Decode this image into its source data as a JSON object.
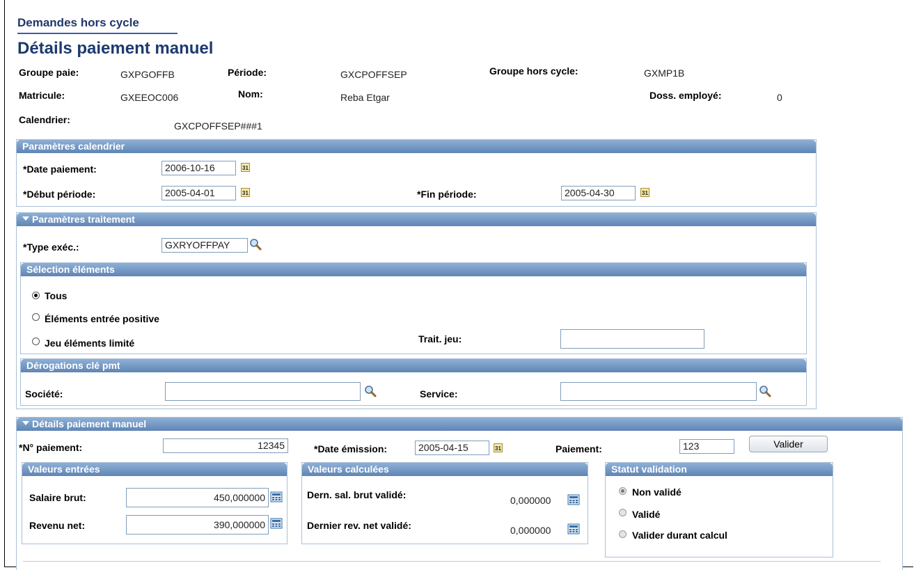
{
  "breadcrumb": "Demandes hors cycle",
  "page_title": "Détails paiement manuel",
  "header": {
    "groupe_paie_label": "Groupe paie:",
    "groupe_paie_value": "GXPGOFFB",
    "periode_label": "Période:",
    "periode_value": "GXCPOFFSEP",
    "groupe_hors_cycle_label": "Groupe hors cycle:",
    "groupe_hors_cycle_value": "GXMP1B",
    "matricule_label": "Matricule:",
    "matricule_value": "GXEEOC006",
    "nom_label": "Nom:",
    "nom_value": "Reba Etgar",
    "doss_label": "Doss. employé:",
    "doss_value": "0",
    "calendrier_label": "Calendrier:",
    "calendrier_value": "GXCPOFFSEP###1"
  },
  "calendar_params": {
    "title": "Paramètres calendrier",
    "date_paiement_label": "*Date paiement:",
    "date_paiement_value": "2006-10-16",
    "debut_label": "*Début période:",
    "debut_value": "2005-04-01",
    "fin_label": "*Fin période:",
    "fin_value": "2005-04-30"
  },
  "process_params": {
    "title": "Paramètres traitement",
    "type_exec_label": "*Type exéc.:",
    "type_exec_value": "GXRYOFFPAY"
  },
  "element_selection": {
    "title": "Sélection éléments",
    "options": [
      "Tous",
      "Éléments entrée positive",
      "Jeu éléments limité"
    ],
    "selected": "Tous",
    "trait_jeu_label": "Trait. jeu:",
    "trait_jeu_value": ""
  },
  "overrides": {
    "title": "Dérogations clé pmt",
    "societe_label": "Société:",
    "societe_value": "",
    "service_label": "Service:",
    "service_value": ""
  },
  "manual_payment": {
    "title": "Détails paiement manuel",
    "no_paiement_label": "*N° paiement:",
    "no_paiement_value": "12345",
    "date_emission_label": "*Date émission:",
    "date_emission_value": "2005-04-15",
    "paiement_label": "Paiement:",
    "paiement_value": "123",
    "valider_button": "Valider"
  },
  "entered_values": {
    "title": "Valeurs entrées",
    "salaire_brut_label": "Salaire brut:",
    "salaire_brut_value": "450,000000",
    "revenu_net_label": "Revenu net:",
    "revenu_net_value": "390,000000"
  },
  "calculated_values": {
    "title": "Valeurs calculées",
    "dern_sal_label": "Dern. sal. brut validé:",
    "dern_sal_value": "0,000000",
    "dernier_rev_label": "Dernier rev. net validé:",
    "dernier_rev_value": "0,000000"
  },
  "validation_status": {
    "title": "Statut validation",
    "options": [
      "Non validé",
      "Validé",
      "Valider durant calcul"
    ],
    "selected": "Non validé"
  },
  "icons": {
    "calendar": "calendar-icon",
    "lookup": "lookup-icon",
    "calculator": "calculator-icon",
    "collapse": "collapse-triangle-icon"
  },
  "colors": {
    "title_blue": "#1c3a70",
    "group_header": "#6f93c0",
    "group_border": "#a9bfd6"
  }
}
